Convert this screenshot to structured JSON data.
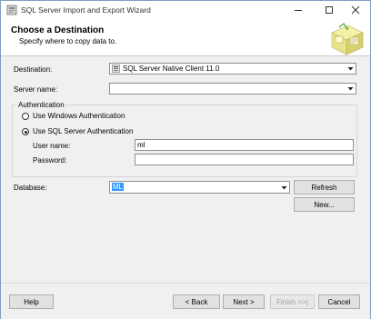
{
  "window": {
    "title": "SQL Server Import and Export Wizard"
  },
  "header": {
    "title": "Choose a Destination",
    "subtitle": "Specify where to copy data to."
  },
  "form": {
    "destination_label": "Destination:",
    "destination_value": "SQL Server Native Client 11.0",
    "server_label": "Server name:",
    "server_value": "",
    "auth_group_label": "Authentication",
    "windows_auth_label": "Use Windows Authentication",
    "sql_auth_label": "Use SQL Server Authentication",
    "auth_selected": "sql",
    "username_label": "User name:",
    "username_value": "ml",
    "password_label": "Password:",
    "password_value": "",
    "database_label": "Database:",
    "database_value": "ML",
    "refresh_label": "Refresh",
    "new_label": "New..."
  },
  "footer": {
    "help_label": "Help",
    "back_label": "< Back",
    "next_label": "Next >",
    "finish_label": "Finish >>|",
    "cancel_label": "Cancel"
  },
  "icons": {
    "app": "wizard-app-icon",
    "destination_provider": "sql-server-provider-icon",
    "header_art": "database-wizard-graphic"
  }
}
